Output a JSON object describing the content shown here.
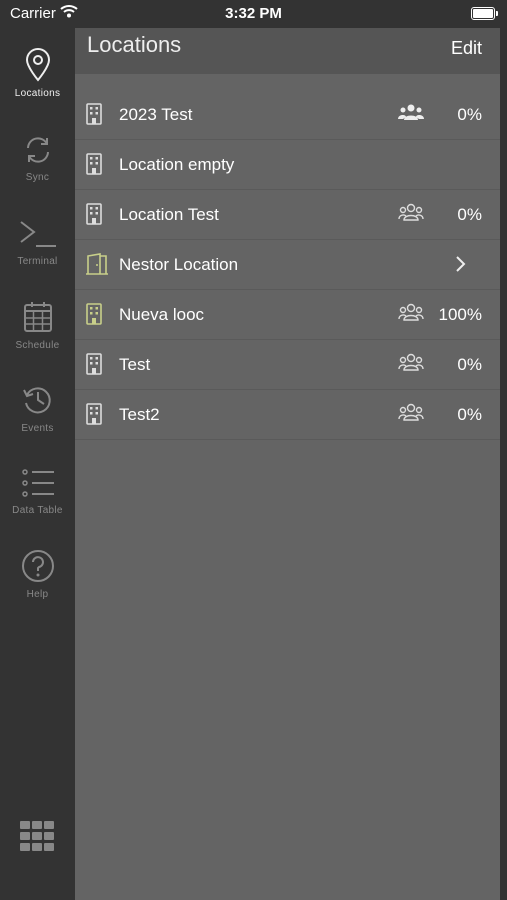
{
  "status_bar": {
    "carrier": "Carrier",
    "time": "3:32 PM"
  },
  "sidebar": {
    "items": [
      {
        "label": "Locations",
        "icon": "location-pin-icon",
        "active": true
      },
      {
        "label": "Sync",
        "icon": "sync-icon",
        "active": false
      },
      {
        "label": "Terminal",
        "icon": "terminal-icon",
        "active": false
      },
      {
        "label": "Schedule",
        "icon": "calendar-icon",
        "active": false
      },
      {
        "label": "Events",
        "icon": "history-icon",
        "active": false
      },
      {
        "label": "Data Table",
        "icon": "list-icon",
        "active": false
      },
      {
        "label": "Help",
        "icon": "help-icon",
        "active": false
      }
    ],
    "bottom_icon": "app-grid-icon"
  },
  "header": {
    "title": "Locations",
    "edit_label": "Edit"
  },
  "locations": [
    {
      "name": "2023 Test",
      "percent": "0%",
      "icon": "building-icon",
      "people_icon": "people-filled-icon"
    },
    {
      "name": "Location empty",
      "percent": "",
      "icon": "building-icon"
    },
    {
      "name": "Location Test",
      "percent": "0%",
      "icon": "building-icon",
      "people_icon": "people-outline-icon"
    },
    {
      "name": "Nestor Location",
      "percent": "",
      "icon": "door-icon",
      "accent": "#c8cf8a",
      "has_chevron": true
    },
    {
      "name": "Nueva looc",
      "percent": "100%",
      "icon": "building-icon",
      "accent": "#c8cf8a",
      "people_icon": "people-outline-icon"
    },
    {
      "name": "Test",
      "percent": "0%",
      "icon": "building-icon",
      "people_icon": "people-outline-icon"
    },
    {
      "name": "Test2",
      "percent": "0%",
      "icon": "building-icon",
      "people_icon": "people-outline-icon"
    }
  ],
  "colors": {
    "sidebar": "#333333",
    "main": "#646464",
    "header": "#555555",
    "accent": "#c8cf8a"
  }
}
